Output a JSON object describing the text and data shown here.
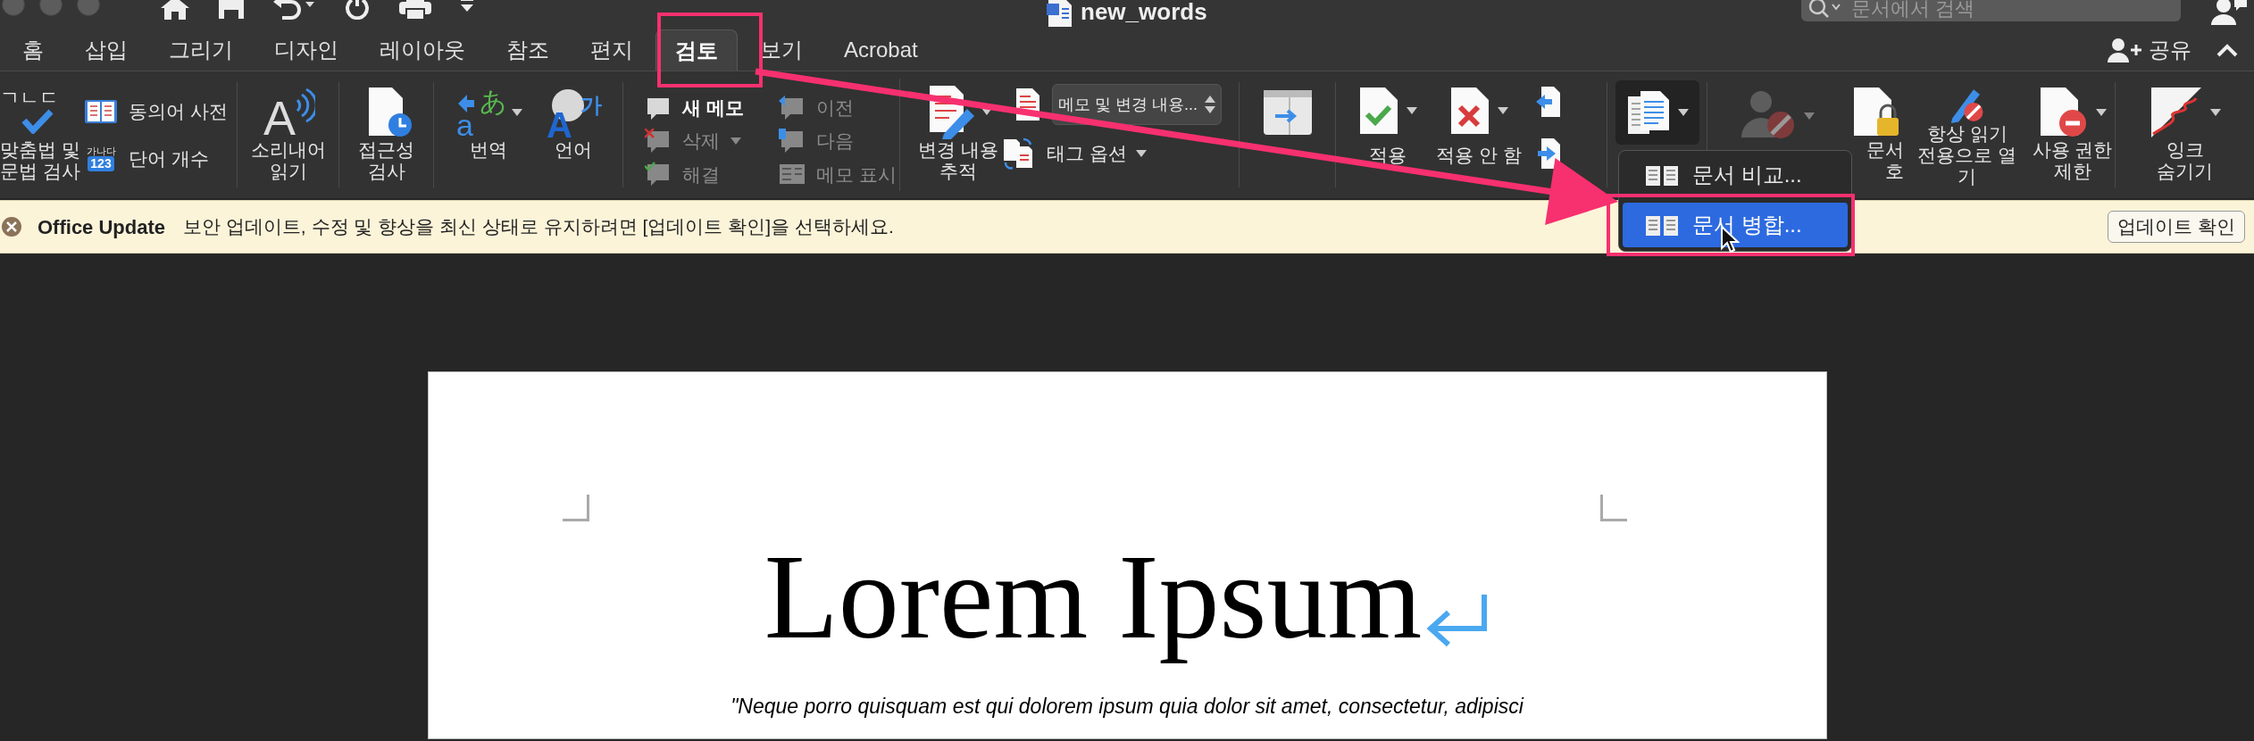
{
  "window": {
    "title": "new_words",
    "search_placeholder": "문서에서 검색"
  },
  "tabs": [
    {
      "label": "홈",
      "selected": false
    },
    {
      "label": "삽입",
      "selected": false
    },
    {
      "label": "그리기",
      "selected": false
    },
    {
      "label": "디자인",
      "selected": false
    },
    {
      "label": "레이아웃",
      "selected": false
    },
    {
      "label": "참조",
      "selected": false
    },
    {
      "label": "편지",
      "selected": false
    },
    {
      "label": "검토",
      "selected": true
    },
    {
      "label": "보기",
      "selected": false
    },
    {
      "label": "Acrobat",
      "selected": false
    }
  ],
  "share": "공유",
  "ribbon": {
    "spelling": {
      "icon_text": "ㄱㄴㄷ",
      "label": "맞춤법 및\n문법 검사"
    },
    "thesaurus": "동의어 사전",
    "word_count": {
      "icon_text": "가나다",
      "icon_number": "123",
      "label": "단어 개수"
    },
    "read_aloud": {
      "icon_text": "A",
      "label": "소리내어\n읽기"
    },
    "accessibility": "접근성\n검사",
    "translate": {
      "icon_text": [
        "あ",
        "a"
      ],
      "label": "번역"
    },
    "language": {
      "icon_text": [
        "A",
        "가"
      ],
      "label": "언어"
    },
    "comments": [
      {
        "label": "새 메모",
        "disabled": false
      },
      {
        "label": "삭제",
        "disabled": true
      },
      {
        "label": "해결",
        "disabled": true
      },
      {
        "label": "이전",
        "disabled": true
      },
      {
        "label": "다음",
        "disabled": true
      },
      {
        "label": "메모 표시",
        "disabled": true
      }
    ],
    "track_changes": "변경 내용\n추적",
    "markup_view": "메모 및 변경 내용...",
    "markup_options": "태그 옵션",
    "accept": "적용",
    "reject": "적용 안 함",
    "protect": "문서\n호",
    "always_read_only": "항상 읽기\n전용으로 열기",
    "restrict": "사용 권한\n제한",
    "ink": "잉크\n숨기기"
  },
  "compare_menu": [
    {
      "label": "문서 비교...",
      "selected": false
    },
    {
      "label": "문서 병합...",
      "selected": true
    }
  ],
  "update_bar": {
    "title": "Office Update",
    "message": "보안 업데이트, 수정 및 향상을 최신 상태로 유지하려면 [업데이트 확인]을 선택하세요.",
    "button": "업데이트 확인"
  },
  "document": {
    "title": "Lorem Ipsum",
    "quote": "\"Neque porro quisquam est qui dolorem ipsum quia dolor sit amet, consectetur, adipisci"
  }
}
